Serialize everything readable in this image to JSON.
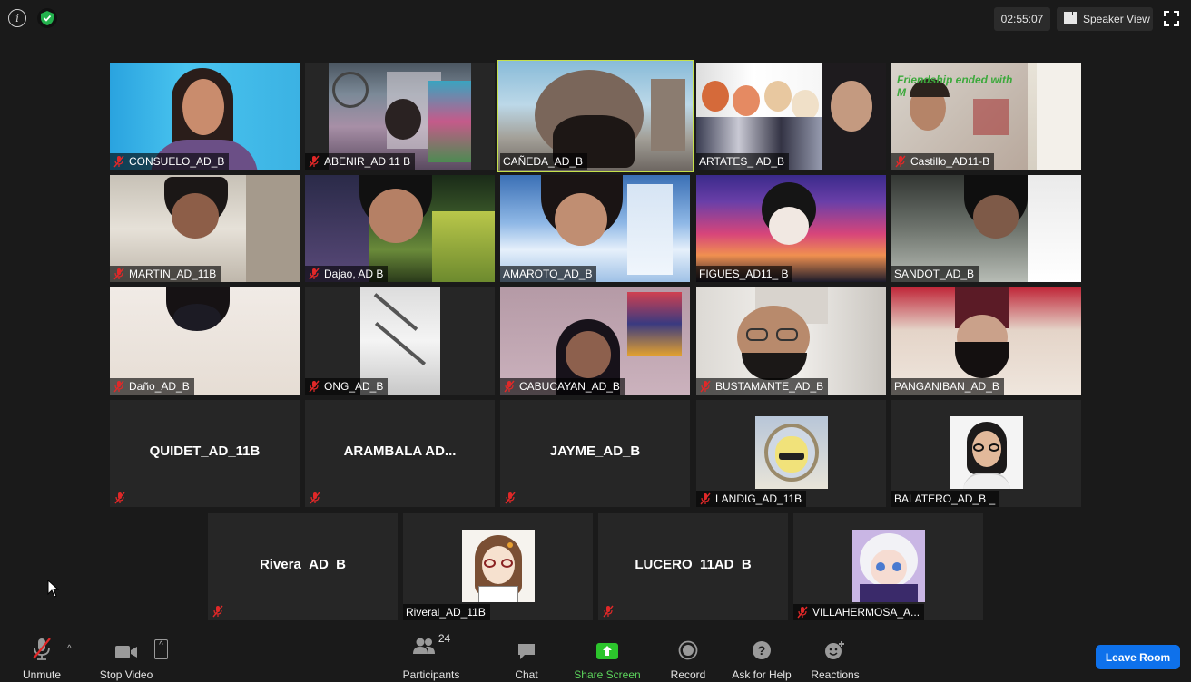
{
  "top_bar": {
    "timer": "02:55:07",
    "view_label": "Speaker View"
  },
  "tiles": [
    {
      "name": "CONSUELO_AD_B"
    },
    {
      "name": "ABENIR_AD 11 B"
    },
    {
      "name": "CAÑEDA_AD_B"
    },
    {
      "name": "ARTATES_ AD_B"
    },
    {
      "name": "Castillo_AD11-B"
    },
    {
      "name": "MARTIN_AD_11B"
    },
    {
      "name": "Dajao, AD B"
    },
    {
      "name": "AMAROTO_AD_B"
    },
    {
      "name": "FIGUES_AD11_ B"
    },
    {
      "name": "SANDOT_AD_B"
    },
    {
      "name": "Daño_AD_B"
    },
    {
      "name": "ONG_AD_B"
    },
    {
      "name": "CABUCAYAN_AD_B"
    },
    {
      "name": "BUSTAMANTE_AD_B"
    },
    {
      "name": "PANGANIBAN_AD_B"
    },
    {
      "name": "QUIDET_AD_11B"
    },
    {
      "name": "ARAMBALA AD..."
    },
    {
      "name": "JAYME_AD_B"
    },
    {
      "name": "LANDIG_AD_11B"
    },
    {
      "name": "BALATERO_AD_B _"
    },
    {
      "name": "Rivera_AD_B"
    },
    {
      "name": "Riveral_AD_11B"
    },
    {
      "name": "LUCERO_11AD_B"
    },
    {
      "name": "VILLAHERMOSA_A..."
    }
  ],
  "toolbar": {
    "unmute": "Unmute",
    "stop_video": "Stop Video",
    "participants": "Participants",
    "participant_count": "24",
    "chat": "Chat",
    "share_screen": "Share Screen",
    "record": "Record",
    "ask_for_help": "Ask for Help",
    "reactions": "Reactions",
    "leave_room": "Leave Room"
  },
  "colors": {
    "active_speaker": "#c5e04b",
    "share_green": "#2cc52c",
    "leave_blue": "#0e71eb",
    "mic_muted_red": "#e02828"
  }
}
